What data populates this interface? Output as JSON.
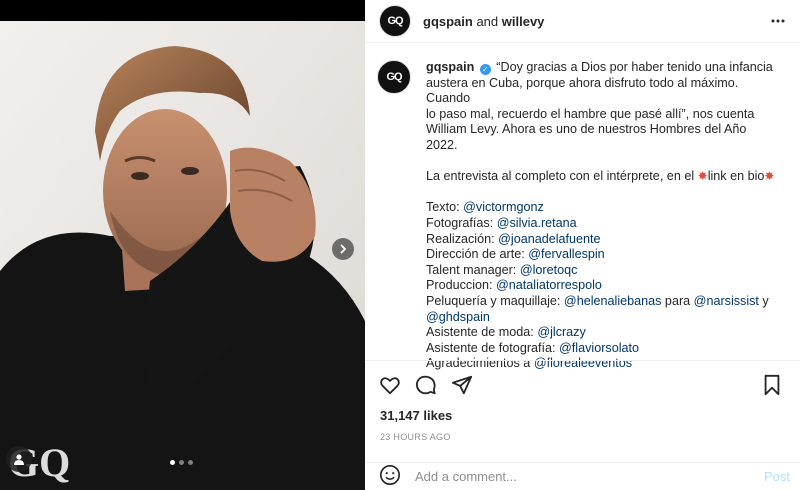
{
  "header": {
    "author": "gqspain",
    "and": " and ",
    "coauthor": "willevy"
  },
  "photo": {
    "watermark": "GQ",
    "carousel_dots": 3,
    "active_dot": 0
  },
  "caption": {
    "username": "gqspain",
    "verified_mark": "✓",
    "lines": [
      "“Doy gracias a Dios por haber tenido una infancia",
      "austera en Cuba, porque ahora disfruto todo al máximo. Cuando",
      "lo paso mal, recuerdo el hambre que pasé allí”, nos cuenta",
      "William Levy. Ahora es uno de nuestros Hombres del Año 2022."
    ],
    "interview_prefix": "La entrevista al completo con el intérprete, en el ",
    "interview_link": "link en bio",
    "credits": [
      {
        "label": "Texto: ",
        "mention": "@victormgonz",
        "suffix": "",
        "mention2": ""
      },
      {
        "label": "Fotografías: ",
        "mention": "@silvia.retana",
        "suffix": "",
        "mention2": ""
      },
      {
        "label": "Realización: ",
        "mention": "@joanadelafuente",
        "suffix": "",
        "mention2": ""
      },
      {
        "label": "Dirección de arte: ",
        "mention": "@fervallespin",
        "suffix": "",
        "mention2": ""
      },
      {
        "label": "Talent manager: ",
        "mention": "@loretoqc",
        "suffix": "",
        "mention2": ""
      },
      {
        "label": "Produccion: ",
        "mention": "@nataliatorrespolo",
        "suffix": "",
        "mention2": ""
      },
      {
        "label": "Peluquería y maquillaje: ",
        "mention": "@helenaliebanas",
        "suffix": " para ",
        "mention2": "@narsissist"
      },
      {
        "label": "",
        "mention": "@ghdspain",
        "suffix": "",
        "mention2": ""
      },
      {
        "label": "Asistente de moda: ",
        "mention": "@jlcrazy",
        "suffix": "",
        "mention2": ""
      },
      {
        "label": "Asistente de fotografía: ",
        "mention": "@flaviorsolato",
        "suffix": "",
        "mention2": ""
      },
      {
        "label": "Agradecimientos a ",
        "mention": "@florealeeventos",
        "suffix": "",
        "mention2": ""
      }
    ],
    "line7_tail": " y"
  },
  "actions": {
    "icons": [
      "heart-icon",
      "comment-icon",
      "share-icon",
      "bookmark-icon"
    ]
  },
  "likes": "31,147 likes",
  "time": "23 HOURS AGO",
  "comment_box": {
    "placeholder": "Add a comment...",
    "post_label": "Post"
  },
  "colors": {
    "mention": "#00376b",
    "verified": "#3897f0",
    "post_disabled": "#b2dffc",
    "muted": "#8e8e8e"
  }
}
